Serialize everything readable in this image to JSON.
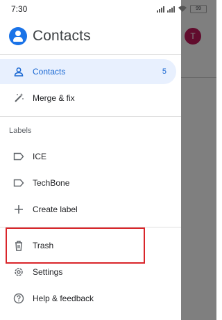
{
  "status_bar": {
    "time": "7:30",
    "battery": "99"
  },
  "background": {
    "avatar_letter": "T"
  },
  "drawer": {
    "title": "Contacts",
    "items": [
      {
        "label": "Contacts",
        "icon": "person-icon",
        "count": "5",
        "active": true
      },
      {
        "label": "Merge & fix",
        "icon": "magic-wand-icon"
      }
    ],
    "labels_heading": "Labels",
    "labels": [
      {
        "label": "ICE",
        "icon": "label-icon"
      },
      {
        "label": "TechBone",
        "icon": "label-icon"
      },
      {
        "label": "Create label",
        "icon": "plus-icon"
      }
    ],
    "bottom_items": [
      {
        "label": "Trash",
        "icon": "trash-icon"
      },
      {
        "label": "Settings",
        "icon": "gear-icon"
      },
      {
        "label": "Help & feedback",
        "icon": "help-icon"
      }
    ]
  },
  "colors": {
    "accent": "#1a73e8",
    "active_bg": "#e8f0fe",
    "highlight": "#d9252a"
  }
}
